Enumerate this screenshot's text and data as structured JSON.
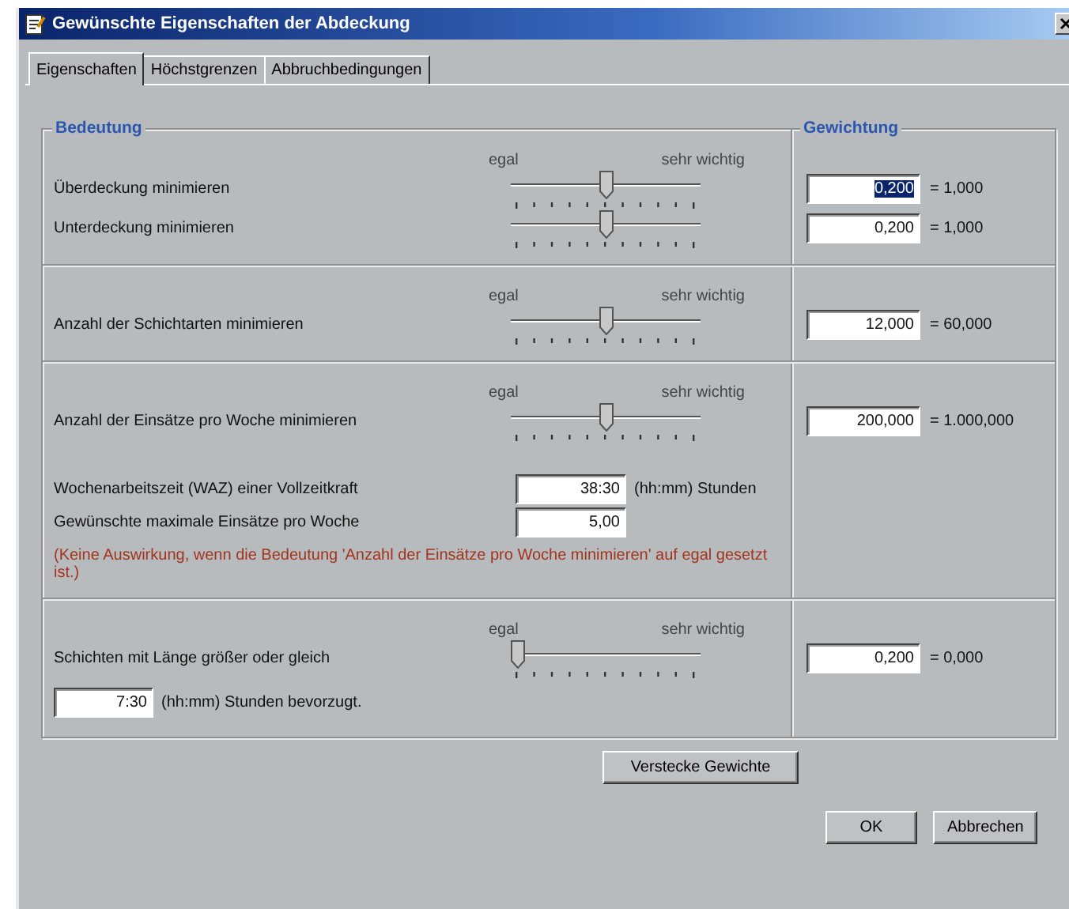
{
  "window": {
    "title": "Gewünschte Eigenschaften der Abdeckung"
  },
  "tabs": [
    {
      "label": "Eigenschaften",
      "selected": true
    },
    {
      "label": "Höchstgrenzen",
      "selected": false
    },
    {
      "label": "Abbruchbedingungen",
      "selected": false
    }
  ],
  "group_titles": {
    "left": "Bedeutung",
    "right": "Gewichtung"
  },
  "sections": [
    {
      "rows": [
        {
          "label": "Überdeckung minimieren",
          "scale": {
            "low": "egal",
            "high": "sehr wichtig"
          },
          "level": 0.5,
          "weight": {
            "value": "0,200",
            "selected": true
          },
          "result": "= 1,000"
        },
        {
          "label": "Unterdeckung minimieren",
          "level": 0.5,
          "weight": {
            "value": "0,200",
            "selected": false
          },
          "result": "= 1,000"
        }
      ]
    },
    {
      "rows": [
        {
          "label": "Anzahl der Schichtarten minimieren",
          "scale": {
            "low": "egal",
            "high": "sehr wichtig"
          },
          "level": 0.5,
          "weight": {
            "value": "12,000",
            "selected": false
          },
          "result": "= 60,000"
        }
      ]
    },
    {
      "rows": [
        {
          "label": "Anzahl der Einsätze pro Woche minimieren",
          "scale": {
            "low": "egal",
            "high": "sehr wichtig"
          },
          "level": 0.5,
          "weight": {
            "value": "200,000",
            "selected": false
          },
          "result": "= 1.000,000"
        }
      ],
      "fields": [
        {
          "label": "Wochenarbeitszeit (WAZ) einer Vollzeitkraft",
          "value": "38:30",
          "unit": "(hh:mm) Stunden"
        },
        {
          "label": "Gewünschte maximale Einsätze pro Woche",
          "value": "5,00"
        }
      ],
      "note": "(Keine Auswirkung, wenn die Bedeutung 'Anzahl der Einsätze pro Woche minimieren' auf egal gesetzt ist.)"
    },
    {
      "rows": [
        {
          "label": "Schichten mit Länge größer oder gleich",
          "scale": {
            "low": "egal",
            "high": "sehr wichtig"
          },
          "level": 0,
          "weight": {
            "value": "0,200",
            "selected": false
          },
          "result": "= 0,000",
          "preference": {
            "value": "7:30",
            "unit": "(hh:mm) Stunden bevorzugt."
          }
        }
      ]
    }
  ],
  "toggle_button": "Verstecke Gewichte",
  "buttons": [
    "OK",
    "Abbrechen"
  ]
}
